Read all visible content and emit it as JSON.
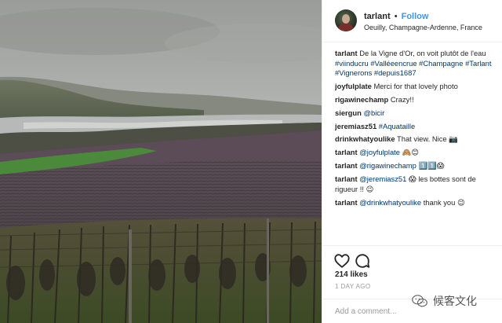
{
  "post": {
    "username": "tarlant",
    "separator": "•",
    "follow_label": "Follow",
    "location": "Oeuilly, Champagne-Ardenne, France"
  },
  "caption": {
    "user": "tarlant",
    "text": "De la Vigne d'Or, on voit plutôt de l'eau",
    "hashtags": "#viinducru #Valléeencrue #Champagne #Tarlant #Vignerons #depuis1687"
  },
  "comments": [
    {
      "user": "joyfulplate",
      "text": "Merci for that lovely photo"
    },
    {
      "user": "rigawinechamp",
      "text": "Crazy!!"
    },
    {
      "user": "siergun",
      "mention": "@bicir",
      "text": ""
    },
    {
      "user": "jeremiasz51",
      "mention": "#Aquataille",
      "text": ""
    },
    {
      "user": "drinkwhatyoulike",
      "text": "That view. Nice 📷"
    },
    {
      "user": "tarlant",
      "mention": "@joyfulplate",
      "text": "🙈😊"
    },
    {
      "user": "tarlant",
      "mention": "@rigawinechamp",
      "text": "1️⃣1️⃣😱"
    },
    {
      "user": "tarlant",
      "mention": "@jeremiasz51",
      "text": "😱 les bottes sont de rigueur !! 😉"
    },
    {
      "user": "tarlant",
      "mention": "@drinkwhatyoulike",
      "text": "thank you 😉"
    }
  ],
  "stats": {
    "likes": "214 likes",
    "time": "1 DAY AGO"
  },
  "add_comment": {
    "placeholder": "Add a comment..."
  },
  "watermark": {
    "text": "候客文化"
  },
  "icons": {
    "like": "heart-icon",
    "comment": "comment-icon",
    "watermark": "wechat-icon"
  },
  "colors": {
    "link": "#3897f0",
    "hashtag": "#003569",
    "meta": "#999999"
  }
}
